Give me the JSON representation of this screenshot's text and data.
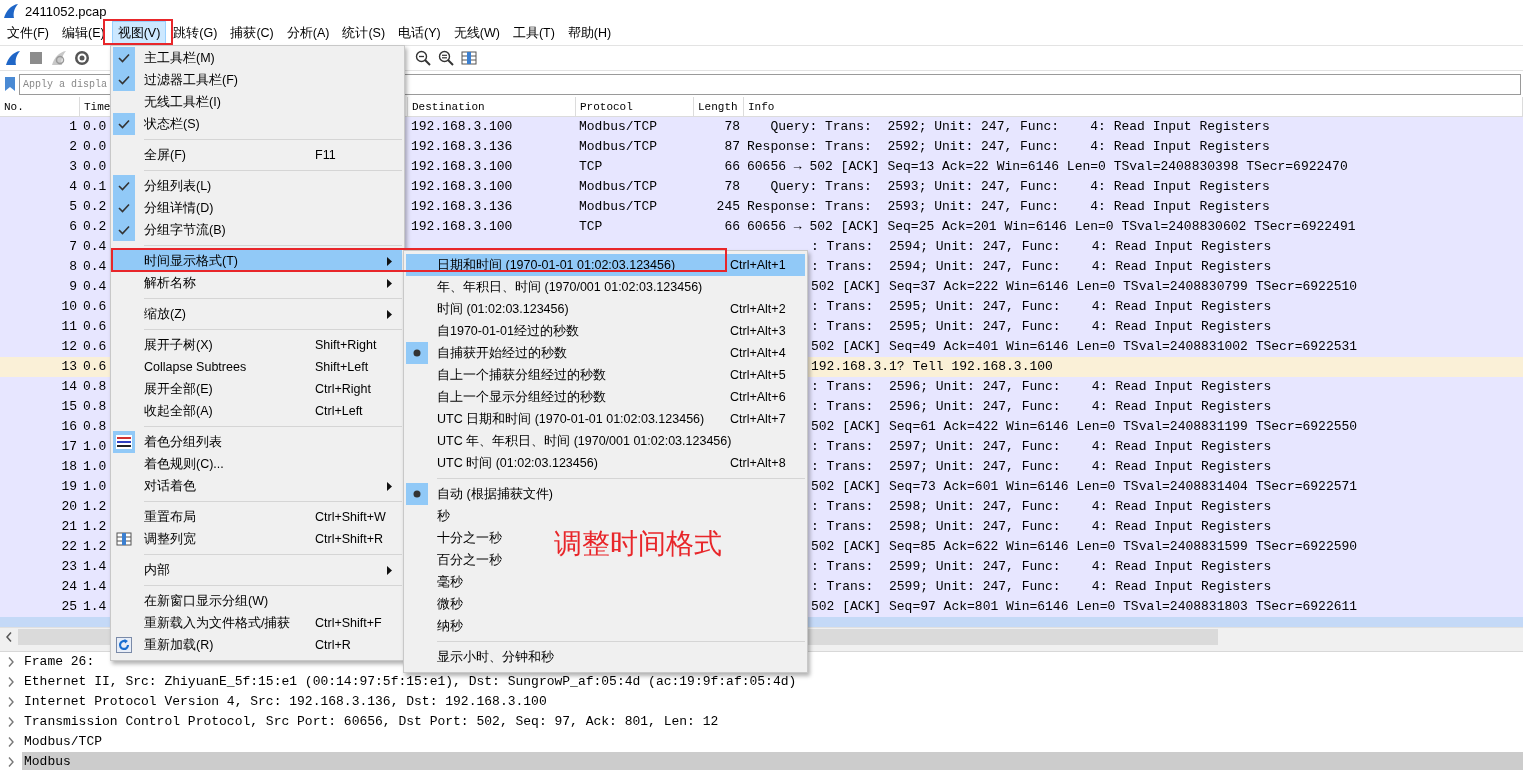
{
  "window": {
    "title": "2411052.pcap"
  },
  "menubar": [
    {
      "label": "文件(F)",
      "selected": false
    },
    {
      "label": "编辑(E)",
      "selected": false
    },
    {
      "label": "视图(V)",
      "selected": true
    },
    {
      "label": "跳转(G)",
      "selected": false
    },
    {
      "label": "捕获(C)",
      "selected": false
    },
    {
      "label": "分析(A)",
      "selected": false
    },
    {
      "label": "统计(S)",
      "selected": false
    },
    {
      "label": "电话(Y)",
      "selected": false
    },
    {
      "label": "无线(W)",
      "selected": false
    },
    {
      "label": "工具(T)",
      "selected": false
    },
    {
      "label": "帮助(H)",
      "selected": false
    }
  ],
  "display_filter": {
    "placeholder": "Apply a displa"
  },
  "packet_list": {
    "columns": [
      "No.",
      "Time",
      "Destination",
      "Protocol",
      "Length",
      "Info"
    ],
    "rows": [
      {
        "no": "1",
        "time": "0.0",
        "kind": "tcp",
        "selected": false,
        "destination": "192.168.3.100",
        "protocol": "Modbus/TCP",
        "length": "78",
        "info": "   Query: Trans:  2592; Unit: 247, Func:    4: Read Input Registers"
      },
      {
        "no": "2",
        "time": "0.0",
        "kind": "tcp",
        "selected": false,
        "destination": "192.168.3.136",
        "protocol": "Modbus/TCP",
        "length": "87",
        "info": "Response: Trans:  2592; Unit: 247, Func:    4: Read Input Registers"
      },
      {
        "no": "3",
        "time": "0.0",
        "kind": "tcp",
        "selected": false,
        "destination": "192.168.3.100",
        "protocol": "TCP",
        "length": "66",
        "info": "60656 → 502 [ACK] Seq=13 Ack=22 Win=6146 Len=0 TSval=2408830398 TSecr=6922470"
      },
      {
        "no": "4",
        "time": "0.1",
        "kind": "tcp",
        "selected": false,
        "destination": "192.168.3.100",
        "protocol": "Modbus/TCP",
        "length": "78",
        "info": "   Query: Trans:  2593; Unit: 247, Func:    4: Read Input Registers"
      },
      {
        "no": "5",
        "time": "0.2",
        "kind": "tcp",
        "selected": false,
        "destination": "192.168.3.136",
        "protocol": "Modbus/TCP",
        "length": "245",
        "info": "Response: Trans:  2593; Unit: 247, Func:    4: Read Input Registers"
      },
      {
        "no": "6",
        "time": "0.2",
        "kind": "tcp",
        "selected": false,
        "destination": "192.168.3.100",
        "protocol": "TCP",
        "length": "66",
        "info": "60656 → 502 [ACK] Seq=25 Ack=201 Win=6146 Len=0 TSval=2408830602 TSecr=6922491"
      },
      {
        "no": "7",
        "time": "0.4",
        "kind": "tcp",
        "selected": false,
        "info_tail": ": Trans:  2594; Unit: 247, Func:    4: Read Input Registers"
      },
      {
        "no": "8",
        "time": "0.4",
        "kind": "tcp",
        "selected": false,
        "info_tail": ": Trans:  2594; Unit: 247, Func:    4: Read Input Registers"
      },
      {
        "no": "9",
        "time": "0.4",
        "kind": "tcp",
        "selected": false,
        "info_tail": "502 [ACK] Seq=37 Ack=222 Win=6146 Len=0 TSval=2408830799 TSecr=6922510"
      },
      {
        "no": "10",
        "time": "0.6",
        "kind": "tcp",
        "selected": false,
        "info_tail": ": Trans:  2595; Unit: 247, Func:    4: Read Input Registers"
      },
      {
        "no": "11",
        "time": "0.6",
        "kind": "tcp",
        "selected": false,
        "info_tail": ": Trans:  2595; Unit: 247, Func:    4: Read Input Registers"
      },
      {
        "no": "12",
        "time": "0.6",
        "kind": "tcp",
        "selected": false,
        "info_tail": "502 [ACK] Seq=49 Ack=401 Win=6146 Len=0 TSval=2408831002 TSecr=6922531"
      },
      {
        "no": "13",
        "time": "0.6",
        "kind": "arp",
        "selected": false,
        "info_tail": "192.168.3.1? Tell 192.168.3.100"
      },
      {
        "no": "14",
        "time": "0.8",
        "kind": "tcp",
        "selected": false,
        "info_tail": ": Trans:  2596; Unit: 247, Func:    4: Read Input Registers"
      },
      {
        "no": "15",
        "time": "0.8",
        "kind": "tcp",
        "selected": false,
        "info_tail": ": Trans:  2596; Unit: 247, Func:    4: Read Input Registers"
      },
      {
        "no": "16",
        "time": "0.8",
        "kind": "tcp",
        "selected": false,
        "info_tail": "502 [ACK] Seq=61 Ack=422 Win=6146 Len=0 TSval=2408831199 TSecr=6922550"
      },
      {
        "no": "17",
        "time": "1.0",
        "kind": "tcp",
        "selected": false,
        "info_tail": ": Trans:  2597; Unit: 247, Func:    4: Read Input Registers"
      },
      {
        "no": "18",
        "time": "1.0",
        "kind": "tcp",
        "selected": false,
        "info_tail": ": Trans:  2597; Unit: 247, Func:    4: Read Input Registers"
      },
      {
        "no": "19",
        "time": "1.0",
        "kind": "tcp",
        "selected": false,
        "info_tail": "502 [ACK] Seq=73 Ack=601 Win=6146 Len=0 TSval=2408831404 TSecr=6922571"
      },
      {
        "no": "20",
        "time": "1.2",
        "kind": "tcp",
        "selected": false,
        "info_tail": ": Trans:  2598; Unit: 247, Func:    4: Read Input Registers"
      },
      {
        "no": "21",
        "time": "1.2",
        "kind": "tcp",
        "selected": false,
        "info_tail": ": Trans:  2598; Unit: 247, Func:    4: Read Input Registers"
      },
      {
        "no": "22",
        "time": "1.2",
        "kind": "tcp",
        "selected": false,
        "info_tail": "502 [ACK] Seq=85 Ack=622 Win=6146 Len=0 TSval=2408831599 TSecr=6922590"
      },
      {
        "no": "23",
        "time": "1.4",
        "kind": "tcp",
        "selected": false,
        "info_tail": ": Trans:  2599; Unit: 247, Func:    4: Read Input Registers"
      },
      {
        "no": "24",
        "time": "1.4",
        "kind": "tcp",
        "selected": false,
        "info_tail": ": Trans:  2599; Unit: 247, Func:    4: Read Input Registers"
      },
      {
        "no": "25",
        "time": "1.4",
        "kind": "tcp",
        "selected": false,
        "info_tail": "502 [ACK] Seq=97 Ack=801 Win=6146 Len=0 TSval=2408831803 TSecr=6922611"
      },
      {
        "kind": "tcp",
        "selected": true
      }
    ]
  },
  "packet_details": {
    "items": [
      {
        "text": "Frame 26:",
        "selected": false
      },
      {
        "text": "Ethernet II, Src: ZhiyuanE_5f:15:e1 (00:14:97:5f:15:e1), Dst: SungrowP_af:05:4d (ac:19:9f:af:05:4d)",
        "selected": false
      },
      {
        "text": "Internet Protocol Version 4, Src: 192.168.3.136, Dst: 192.168.3.100",
        "selected": false
      },
      {
        "text": "Transmission Control Protocol, Src Port: 60656, Dst Port: 502, Seq: 97, Ack: 801, Len: 12",
        "selected": false
      },
      {
        "text": "Modbus/TCP",
        "selected": false
      },
      {
        "text": "Modbus",
        "selected": true
      }
    ]
  },
  "view_menu": {
    "items": [
      {
        "kind": "check",
        "label": "主工具栏(M)",
        "checked": true,
        "selected": false
      },
      {
        "kind": "check",
        "label": "过滤器工具栏(F)",
        "checked": true,
        "selected": false
      },
      {
        "kind": "check",
        "label": "无线工具栏(I)",
        "checked": false,
        "selected": false
      },
      {
        "kind": "check",
        "label": "状态栏(S)",
        "checked": true,
        "selected": false
      },
      {
        "kind": "separator"
      },
      {
        "kind": "action",
        "label": "全屏(F)",
        "shortcut": "F11",
        "selected": false
      },
      {
        "kind": "separator"
      },
      {
        "kind": "check",
        "label": "分组列表(L)",
        "checked": true,
        "selected": false
      },
      {
        "kind": "check",
        "label": "分组详情(D)",
        "checked": true,
        "selected": false
      },
      {
        "kind": "check",
        "label": "分组字节流(B)",
        "checked": true,
        "selected": false
      },
      {
        "kind": "separator"
      },
      {
        "kind": "submenu",
        "label": "时间显示格式(T)",
        "selected": true
      },
      {
        "kind": "submenu",
        "label": "解析名称",
        "selected": false
      },
      {
        "kind": "separator"
      },
      {
        "kind": "submenu",
        "label": "缩放(Z)",
        "selected": false
      },
      {
        "kind": "separator"
      },
      {
        "kind": "action",
        "label": "展开子树(X)",
        "shortcut": "Shift+Right",
        "selected": false
      },
      {
        "kind": "action",
        "label": "Collapse Subtrees",
        "shortcut": "Shift+Left",
        "selected": false
      },
      {
        "kind": "action",
        "label": "展开全部(E)",
        "shortcut": "Ctrl+Right",
        "selected": false
      },
      {
        "kind": "action",
        "label": "收起全部(A)",
        "shortcut": "Ctrl+Left",
        "selected": false
      },
      {
        "kind": "separator"
      },
      {
        "kind": "toggle",
        "label": "着色分组列表",
        "checked": true,
        "selected": false
      },
      {
        "kind": "action",
        "label": "着色规则(C)...",
        "selected": false
      },
      {
        "kind": "submenu",
        "label": "对话着色",
        "selected": false
      },
      {
        "kind": "separator"
      },
      {
        "kind": "action",
        "label": "重置布局",
        "shortcut": "Ctrl+Shift+W",
        "selected": false
      },
      {
        "kind": "icon-action",
        "label": "调整列宽",
        "shortcut": "Ctrl+Shift+R",
        "selected": false
      },
      {
        "kind": "separator"
      },
      {
        "kind": "submenu",
        "label": "内部",
        "selected": false
      },
      {
        "kind": "separator"
      },
      {
        "kind": "action",
        "label": "在新窗口显示分组(W)",
        "selected": false
      },
      {
        "kind": "action",
        "label": "重新载入为文件格式/捕获",
        "shortcut": "Ctrl+Shift+F",
        "selected": false
      },
      {
        "kind": "icon-action",
        "label": "重新加载(R)",
        "shortcut": "Ctrl+R",
        "selected": false
      }
    ]
  },
  "time_format_menu": {
    "items": [
      {
        "kind": "radio",
        "label": "日期和时间 (1970-01-01 01:02:03.123456)",
        "shortcut": "Ctrl+Alt+1",
        "checked": false,
        "selected": true
      },
      {
        "kind": "radio",
        "label": "年、年积日、时间 (1970/001 01:02:03.123456)",
        "checked": false,
        "selected": false
      },
      {
        "kind": "radio",
        "label": "时间 (01:02:03.123456)",
        "shortcut": "Ctrl+Alt+2",
        "checked": false,
        "selected": false
      },
      {
        "kind": "radio",
        "label": "自1970-01-01经过的秒数",
        "shortcut": "Ctrl+Alt+3",
        "checked": false,
        "selected": false
      },
      {
        "kind": "radio",
        "label": "自捕获开始经过的秒数",
        "shortcut": "Ctrl+Alt+4",
        "checked": true,
        "selected": false
      },
      {
        "kind": "radio",
        "label": "自上一个捕获分组经过的秒数",
        "shortcut": "Ctrl+Alt+5",
        "checked": false,
        "selected": false
      },
      {
        "kind": "radio",
        "label": "自上一个显示分组经过的秒数",
        "shortcut": "Ctrl+Alt+6",
        "checked": false,
        "selected": false
      },
      {
        "kind": "radio",
        "label": "UTC 日期和时间 (1970-01-01 01:02:03.123456)",
        "shortcut": "Ctrl+Alt+7",
        "checked": false,
        "selected": false
      },
      {
        "kind": "radio",
        "label": "UTC 年、年积日、时间 (1970/001 01:02:03.123456)",
        "checked": false,
        "selected": false
      },
      {
        "kind": "radio",
        "label": "UTC 时间 (01:02:03.123456)",
        "shortcut": "Ctrl+Alt+8",
        "checked": false,
        "selected": false
      },
      {
        "kind": "separator"
      },
      {
        "kind": "radio",
        "label": "自动 (根据捕获文件)",
        "checked": true,
        "selected": false
      },
      {
        "kind": "radio",
        "label": "秒",
        "checked": false,
        "selected": false
      },
      {
        "kind": "radio",
        "label": "十分之一秒",
        "checked": false,
        "selected": false
      },
      {
        "kind": "radio",
        "label": "百分之一秒",
        "checked": false,
        "selected": false
      },
      {
        "kind": "radio",
        "label": "毫秒",
        "checked": false,
        "selected": false
      },
      {
        "kind": "radio",
        "label": "微秒",
        "checked": false,
        "selected": false
      },
      {
        "kind": "radio",
        "label": "纳秒",
        "checked": false,
        "selected": false
      },
      {
        "kind": "separator"
      },
      {
        "kind": "check",
        "label": "显示小时、分钟和秒",
        "checked": false,
        "selected": false
      }
    ]
  },
  "annotation": {
    "text": "调整时间格式"
  }
}
